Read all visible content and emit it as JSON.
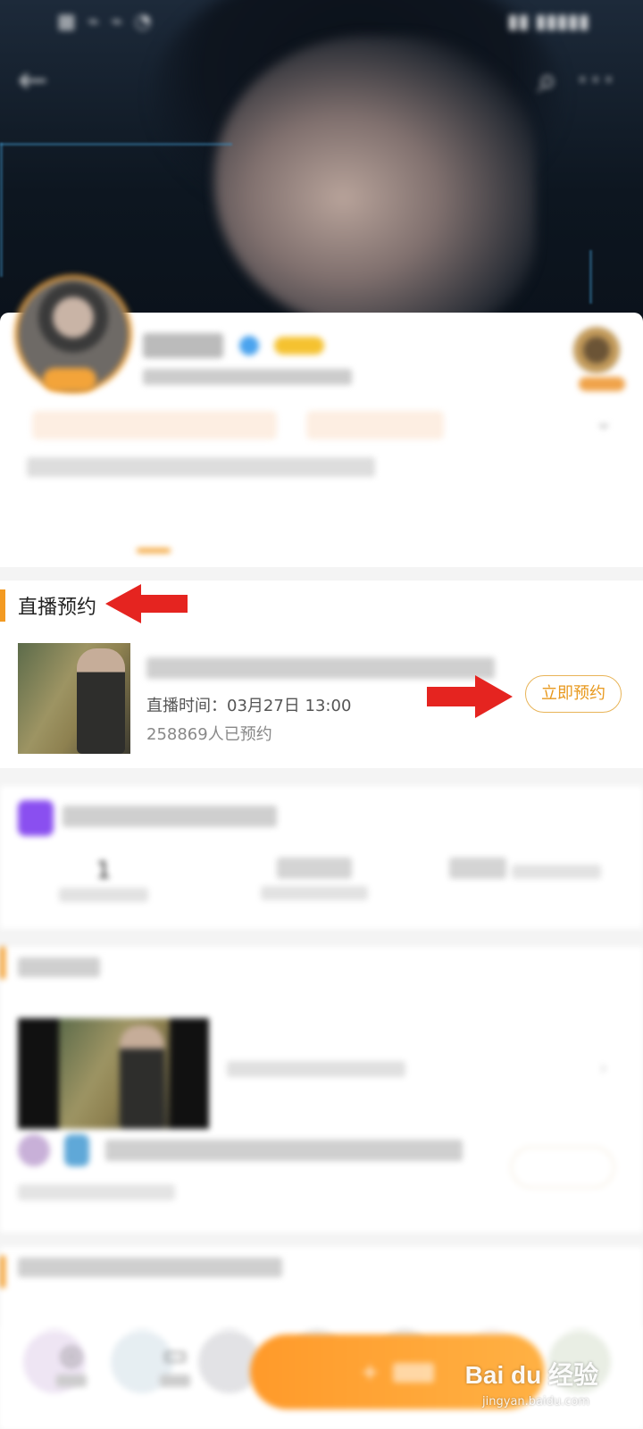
{
  "status_bar": {
    "left": "▩ ⌁ ⌁ ◔",
    "right": "▮▮ ▮▮▮▮▮"
  },
  "header": {
    "back_icon": "←",
    "search_icon": "⌕",
    "more_icon": "···"
  },
  "profile": {
    "name": "",
    "stats": "",
    "tags": [
      "",
      ""
    ],
    "bio": ""
  },
  "tabs": [
    "",
    "",
    "",
    ""
  ],
  "live": {
    "section_title": "直播预约",
    "more": "",
    "title": "",
    "time": "直播时间：03月27日 13:00",
    "count": "258869人已预约",
    "button": "立即预约"
  },
  "rank": {
    "title": "",
    "more": "",
    "stats": [
      {
        "value": "1",
        "label": ""
      },
      {
        "value": "",
        "label": ""
      },
      {
        "value": "",
        "label": ""
      }
    ]
  },
  "video": {
    "section_title": "",
    "meta": "",
    "reply_text": "",
    "reply_sub": "",
    "reply_button": ""
  },
  "group": {
    "title": "",
    "more": ""
  },
  "bottom": {
    "item1_icon": "◎",
    "item1_label": "",
    "item2_icon": "▭",
    "item2_label": "",
    "follow": "+"
  },
  "watermark": {
    "brand": "Bai du 经验",
    "url": "jingyan.baidu.com"
  },
  "colors": {
    "accent": "#f39a22",
    "button_text": "#e8991e",
    "arrow": "#e52420"
  }
}
